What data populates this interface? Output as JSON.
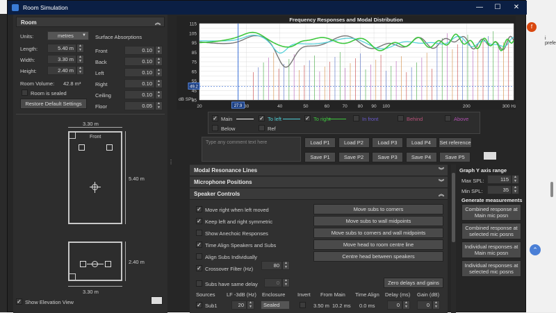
{
  "background": {
    "avatar": "f",
    "side_text": "i preferiti"
  },
  "window": {
    "title": "Room Simulation",
    "min": "—",
    "max": "☐",
    "close": "✕"
  },
  "room": {
    "header": "Room",
    "units_label": "Units:",
    "units_value": "metres",
    "length_label": "Length:",
    "length": "5.40 m",
    "width_label": "Width:",
    "width": "3.30 m",
    "height_label": "Height:",
    "height": "2.40 m",
    "volume_label": "Room Volume:",
    "volume": "42.8 m³",
    "sealed_label": "Room is sealed",
    "restore_label": "Restore Default Settings",
    "absorptions_label": "Surface Absorptions",
    "surfaces": [
      {
        "name": "Front",
        "value": "0.10"
      },
      {
        "name": "Back",
        "value": "0.10"
      },
      {
        "name": "Left",
        "value": "0.10"
      },
      {
        "name": "Right",
        "value": "0.10"
      },
      {
        "name": "Ceiling",
        "value": "0.10"
      },
      {
        "name": "Floor",
        "value": "0.05"
      }
    ]
  },
  "plan": {
    "top_dim": "3.30 m",
    "front_label": "Front",
    "side_dim": "5.40 m",
    "elev_side_dim": "2.40 m",
    "elev_bottom_dim": "3.30 m",
    "show_elevation_label": "Show Elevation View"
  },
  "graph": {
    "title": "Frequency Responses and Modal Distribution",
    "y_ticks": [
      "115",
      "105",
      "95",
      "85",
      "75",
      "65",
      "55",
      "45",
      "35"
    ],
    "y_unit": "dB SPL",
    "x_ticks": [
      "20",
      "30",
      "40",
      "50",
      "60",
      "70",
      "80",
      "90",
      "100",
      "200",
      "300 Hz"
    ],
    "cursor_x": "27.9",
    "cursor_y": "49.2"
  },
  "legend": [
    {
      "label": "Main",
      "checked": true,
      "color": "#ffffff"
    },
    {
      "label": "To left",
      "checked": true,
      "color": "#4fd0d8"
    },
    {
      "label": "To right",
      "checked": true,
      "color": "#3ec83e"
    },
    {
      "label": "In front",
      "checked": false,
      "color": "#6a5acd"
    },
    {
      "label": "Behind",
      "checked": false,
      "color": "#b8527a"
    },
    {
      "label": "Above",
      "checked": false,
      "color": "#b050b0"
    },
    {
      "label": "Below",
      "checked": false,
      "color": "#cccccc"
    },
    {
      "label": "Ref",
      "checked": false,
      "color": "#cccccc"
    }
  ],
  "comment_placeholder": "Type any comment text here",
  "load_buttons": [
    "Load P1",
    "Load P2",
    "Load P3",
    "Load P4",
    "Load P5"
  ],
  "save_buttons": [
    "Save P1",
    "Save P2",
    "Save P3",
    "Save P4",
    "Save P5"
  ],
  "set_reference": "Set reference",
  "sections": {
    "modal": "Modal Resonance Lines",
    "mic": "Microphone Positions",
    "speaker": "Speaker Controls"
  },
  "speaker": {
    "checks": [
      {
        "label": "Move right when left moved",
        "checked": true
      },
      {
        "label": "Keep left and right symmetric",
        "checked": true
      },
      {
        "label": "Show Anechoic Responses",
        "checked": false
      },
      {
        "label": "Time Align Speakers and Subs",
        "checked": true
      },
      {
        "label": "Align Subs Individually",
        "checked": false
      },
      {
        "label": "Crossover Filter (Hz)",
        "checked": true
      }
    ],
    "crossover_value": "80",
    "buttons": [
      "Move subs to corners",
      "Move subs to wall midpoints",
      "Move subs to corners and wall midpoints",
      "Move head to room centre line",
      "Centre head between speakers"
    ],
    "subs_delay_label": "Subs have same delay",
    "subs_delay_value": "0",
    "zero_label": "Zero delays and gains",
    "columns": [
      "Sources",
      "LF -3dB (Hz)",
      "Enclosure",
      "Invert",
      "From Main",
      "Time Align",
      "Delay (ms)",
      "Gain (dB)"
    ],
    "row": {
      "name": "Sub1",
      "lf": "20",
      "enclosure": "Sealed",
      "from_main": "3.50 m",
      "from_main2": "10.2 ms",
      "time_align": "0.0 ms",
      "delay": "0",
      "gain": "0"
    }
  },
  "y_range": {
    "title": "Graph Y axis range",
    "max_label": "Max SPL:",
    "max": "115",
    "min_label": "Min SPL:",
    "min": "35"
  },
  "measurements": {
    "title": "Generate measurements",
    "buttons": [
      "Combined response at Main mic posn",
      "Combined response at selected mic posns",
      "Individual responses at Main mic posn",
      "Individual responses at selected mic posns"
    ]
  }
}
